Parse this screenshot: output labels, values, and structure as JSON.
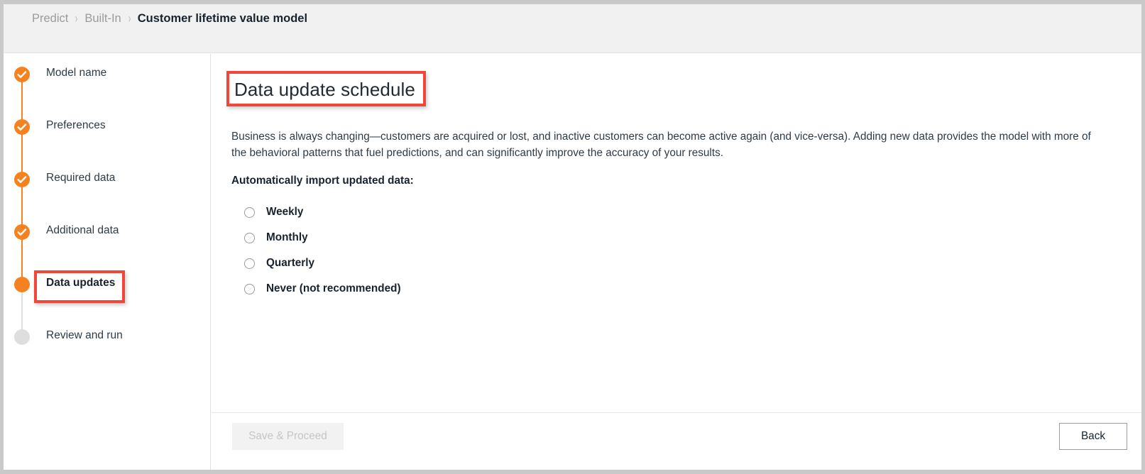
{
  "header": {
    "breadcrumb": [
      {
        "label": "Predict",
        "current": false
      },
      {
        "label": "Built-In",
        "current": false
      },
      {
        "label": "Customer lifetime value model",
        "current": true
      }
    ],
    "separator": "›"
  },
  "sidebar": {
    "steps": [
      {
        "label": "Model name",
        "state": "complete"
      },
      {
        "label": "Preferences",
        "state": "complete"
      },
      {
        "label": "Required data",
        "state": "complete"
      },
      {
        "label": "Additional data",
        "state": "complete"
      },
      {
        "label": "Data updates",
        "state": "current",
        "annotated": true
      },
      {
        "label": "Review and run",
        "state": "pending"
      }
    ]
  },
  "main": {
    "title": "Data update schedule",
    "title_annotated": true,
    "description": "Business is always changing—customers are acquired or lost, and inactive customers can become active again (and vice-versa). Adding new data provides the model with more of the behavioral patterns that fuel predictions, and can significantly improve the accuracy of your results.",
    "form_label": "Automatically import updated data:",
    "radio_group_name": "import-frequency",
    "radio_options": [
      {
        "label": "Weekly",
        "value": "weekly",
        "selected": false
      },
      {
        "label": "Monthly",
        "value": "monthly",
        "selected": false
      },
      {
        "label": "Quarterly",
        "value": "quarterly",
        "selected": false
      },
      {
        "label": "Never (not recommended)",
        "value": "never",
        "selected": false
      }
    ]
  },
  "footer": {
    "save_label": "Save & Proceed",
    "save_disabled": true,
    "back_label": "Back"
  },
  "colors": {
    "accent_orange": "#f58220",
    "annotation_red": "#f2463a",
    "pending_gray": "#dedede",
    "header_bg": "#f1f1f1",
    "text_dark": "#18232e",
    "text_muted": "#9b9b9b"
  }
}
